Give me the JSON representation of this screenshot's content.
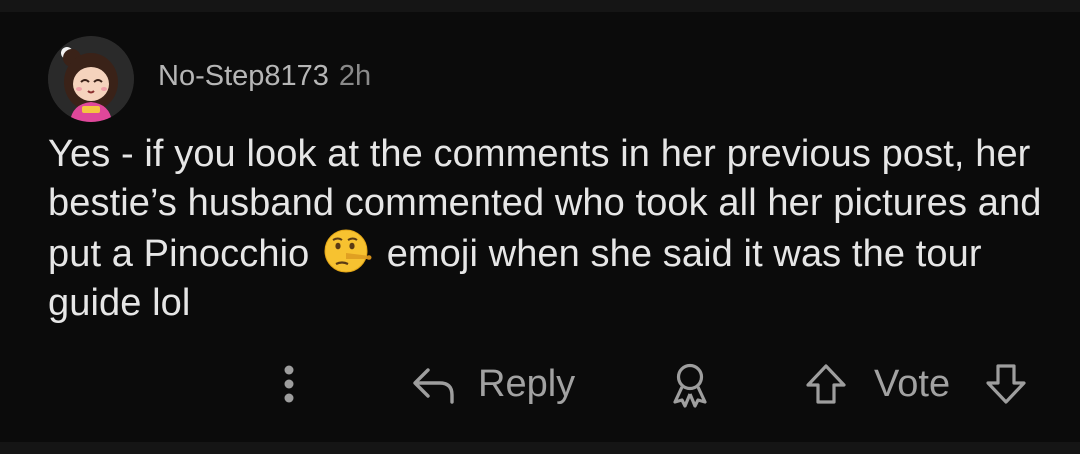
{
  "comment": {
    "username": "No-Step8173",
    "timestamp": "2h",
    "body": {
      "part1": "Yes - if you look at the comments in her previous post, her bestie’s husband commented who took all her pictures and put a Pinocchio",
      "emoji": "lying-face-emoji",
      "part2": "emoji when she said it was the tour guide lol"
    }
  },
  "actions": {
    "more": "more-options-icon",
    "reply_label": "Reply",
    "award": "award-icon",
    "upvote": "upvote-arrow-icon",
    "vote_label": "Vote",
    "downvote": "downvote-arrow-icon"
  },
  "colors": {
    "background": "#0b0b0b",
    "text": "#e6e6e6",
    "muted": "#8a8a8a",
    "icon": "#9e9e9e"
  }
}
